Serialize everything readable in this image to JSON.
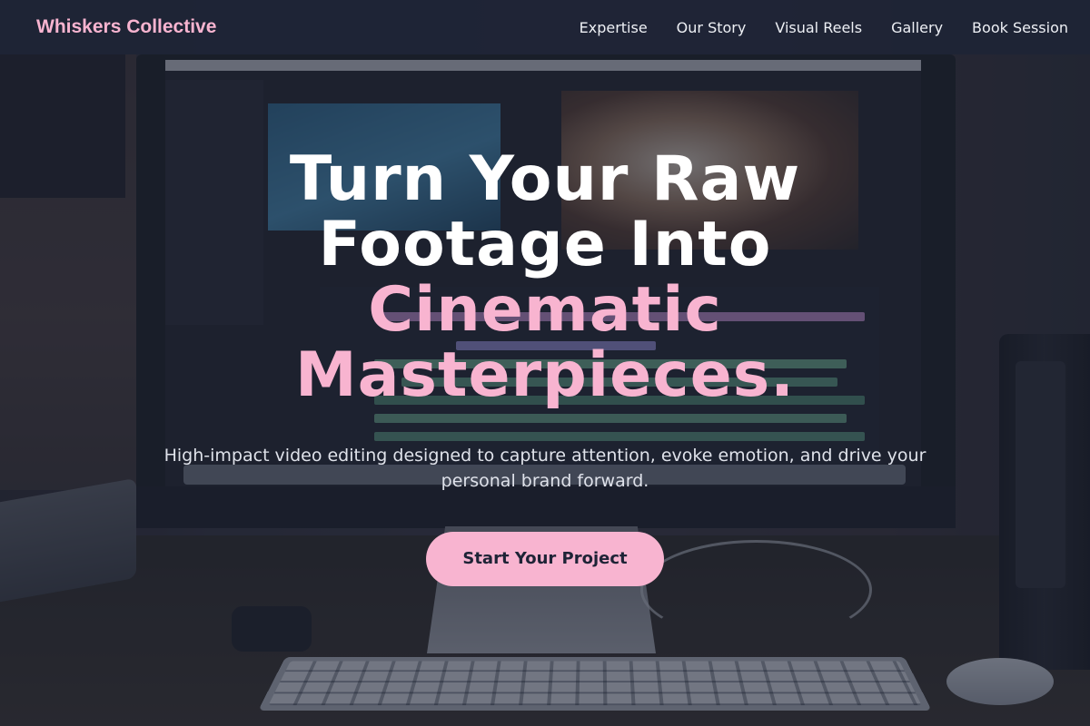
{
  "brand": {
    "name": "Whiskers Collective",
    "accent_color": "#f8b4d0"
  },
  "nav": {
    "items": [
      {
        "label": "Expertise"
      },
      {
        "label": "Our Story"
      },
      {
        "label": "Visual Reels"
      },
      {
        "label": "Gallery"
      },
      {
        "label": "Book Session"
      }
    ]
  },
  "hero": {
    "headline_line1": "Turn Your Raw",
    "headline_line2": "Footage Into",
    "headline_accent_line1": "Cinematic",
    "headline_accent_line2": "Masterpieces.",
    "subheadline": "High-impact video editing designed to capture attention, evoke emotion, and drive your personal brand forward.",
    "cta_label": "Start Your Project"
  },
  "background": {
    "subject": "video editing workstation photo",
    "overlay_color": "#1c2234"
  }
}
